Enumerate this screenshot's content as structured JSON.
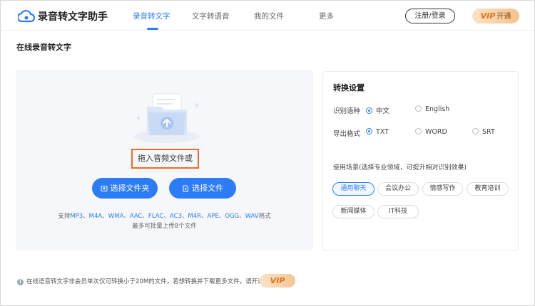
{
  "app": {
    "title": "录音转文字助手"
  },
  "nav": [
    {
      "label": "录音转文字",
      "active": true
    },
    {
      "label": "文字转语音",
      "active": false
    },
    {
      "label": "我的文件",
      "active": false
    },
    {
      "label": "更多",
      "active": false
    }
  ],
  "header": {
    "login_label": "注册/登录",
    "vip_word": "VIP",
    "vip_label": "开通"
  },
  "page": {
    "title": "在线录音转文字"
  },
  "upload": {
    "drag_text": "拖入音频文件或",
    "folder_button": "选择文件夹",
    "file_button": "选择文件",
    "formats_prefix": "支持",
    "formats": "MP3、M4A、WMA、AAC、FLAC、AC3、M4R、APE、OGG、WAV",
    "formats_suffix": "格式",
    "limit": "最多可批量上传8个文件"
  },
  "settings": {
    "title": "转换设置",
    "language": {
      "label": "识别语种",
      "options": [
        {
          "label": "中文",
          "selected": true
        },
        {
          "label": "English",
          "selected": false
        }
      ]
    },
    "export": {
      "label": "导出格式",
      "options": [
        {
          "label": "TXT",
          "selected": true
        },
        {
          "label": "WORD",
          "selected": false
        },
        {
          "label": "SRT",
          "selected": false
        }
      ]
    },
    "scene_label": "使用场景(选择专业领域，可提升相对识别效果)",
    "scenes": [
      {
        "label": "通用聊天",
        "selected": true
      },
      {
        "label": "会议办公",
        "selected": false
      },
      {
        "label": "情感写作",
        "selected": false
      },
      {
        "label": "教育培训",
        "selected": false
      },
      {
        "label": "新闻媒体",
        "selected": false
      },
      {
        "label": "IT科技",
        "selected": false
      }
    ]
  },
  "notice": {
    "text": "在线语音转文字非会员单次仅可转换小于20M的文件，若想转换并下载更多文件，请开通",
    "vip_label": "VIP"
  },
  "colors": {
    "accent": "#2b7cf6",
    "highlight_border": "#f06a2a",
    "vip_gold": "#e0731a"
  }
}
